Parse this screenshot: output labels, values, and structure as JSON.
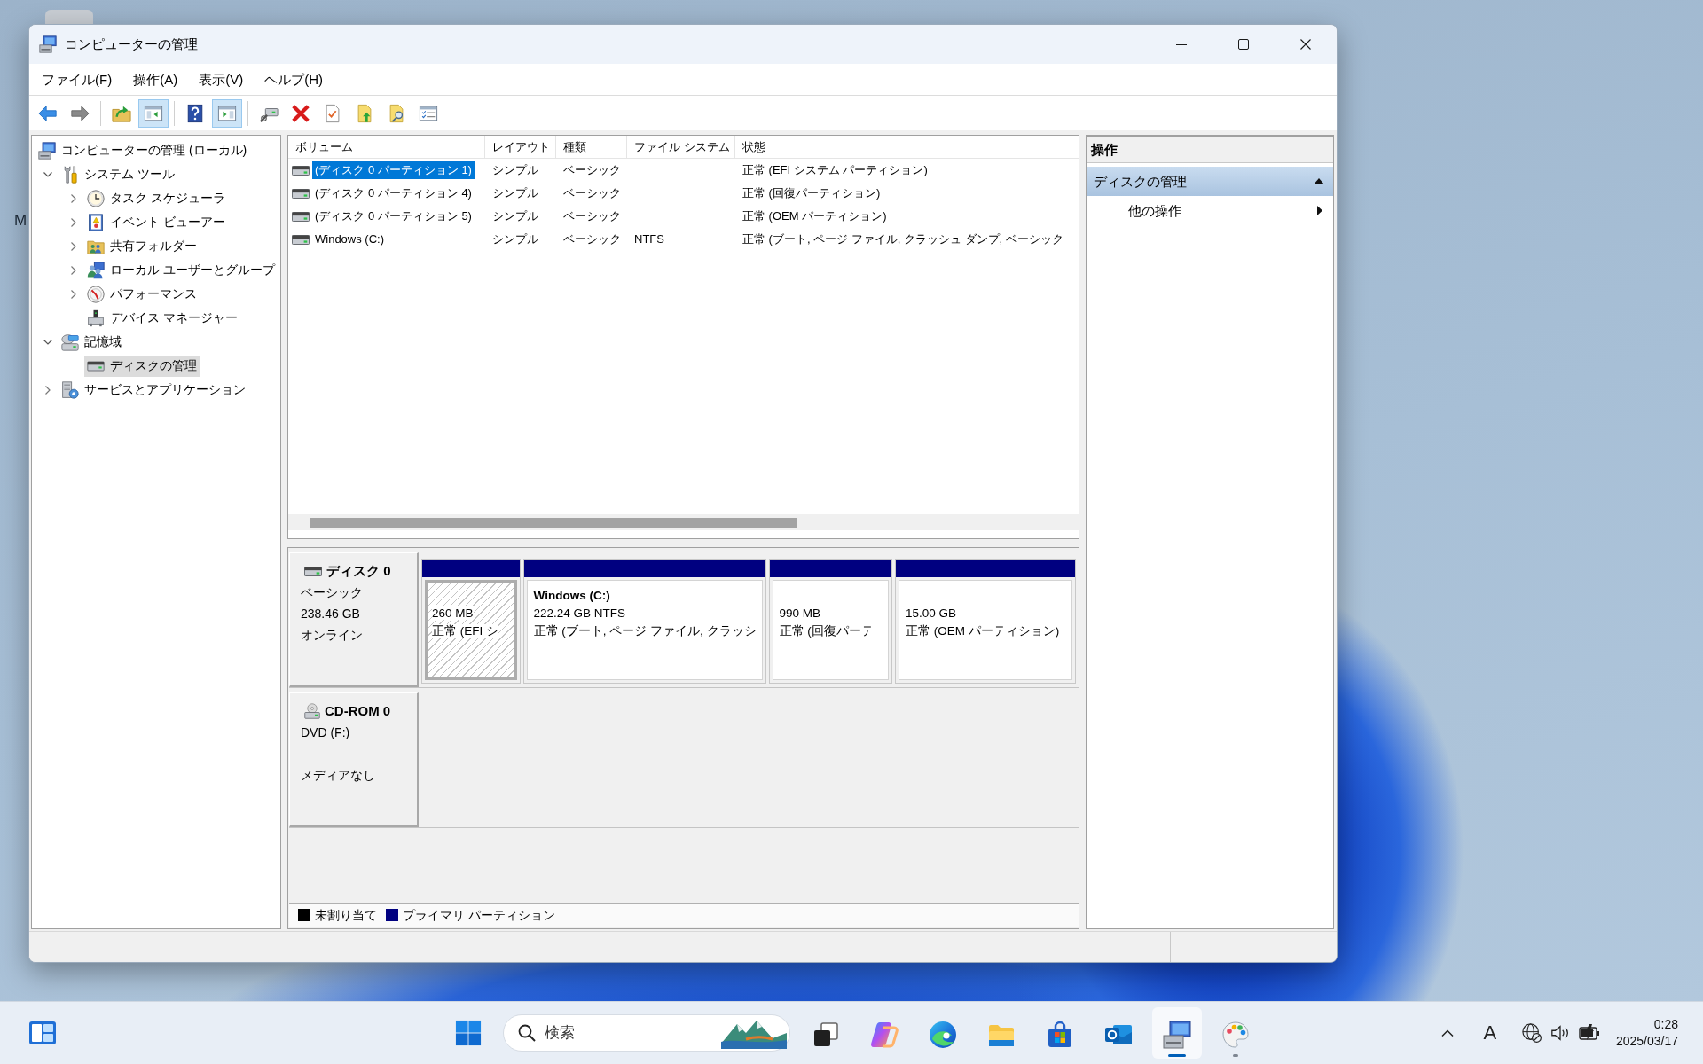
{
  "desktop": {
    "edge_text": "M"
  },
  "window": {
    "title": "コンピューターの管理"
  },
  "menu": [
    "ファイル(F)",
    "操作(A)",
    "表示(V)",
    "ヘルプ(H)"
  ],
  "toolbar": [
    [
      {
        "kind": "back",
        "pressed": false,
        "disabled": false
      },
      {
        "kind": "forward",
        "pressed": false,
        "disabled": true
      }
    ],
    [
      {
        "kind": "up",
        "pressed": false,
        "disabled": false
      },
      {
        "kind": "tree",
        "pressed": true,
        "disabled": false
      }
    ],
    [
      {
        "kind": "help",
        "pressed": false,
        "disabled": false
      },
      {
        "kind": "pane",
        "pressed": true,
        "disabled": false
      }
    ],
    [
      {
        "kind": "connect",
        "pressed": false,
        "disabled": false
      },
      {
        "kind": "delete",
        "pressed": false,
        "disabled": false
      },
      {
        "kind": "properties",
        "pressed": false,
        "disabled": false
      },
      {
        "kind": "export",
        "pressed": false,
        "disabled": false
      },
      {
        "kind": "find",
        "pressed": false,
        "disabled": false
      },
      {
        "kind": "list",
        "pressed": false,
        "disabled": false
      }
    ]
  ],
  "tree": {
    "label": "コンピューターの管理 (ローカル)",
    "kind": "computer",
    "selected": false,
    "children": [
      {
        "label": "システム ツール",
        "kind": "tools",
        "expanded": true,
        "selected": false,
        "children": [
          {
            "label": "タスク スケジューラ",
            "kind": "clock",
            "expanded": false,
            "selected": false
          },
          {
            "label": "イベント ビューアー",
            "kind": "events",
            "expanded": false,
            "selected": false
          },
          {
            "label": "共有フォルダー",
            "kind": "shared",
            "expanded": false,
            "selected": false
          },
          {
            "label": "ローカル ユーザーとグループ",
            "kind": "users",
            "expanded": false,
            "selected": false
          },
          {
            "label": "パフォーマンス",
            "kind": "performance",
            "expanded": false,
            "selected": false
          },
          {
            "label": "デバイス マネージャー",
            "kind": "devices",
            "selected": false
          }
        ]
      },
      {
        "label": "記憶域",
        "kind": "storage",
        "expanded": true,
        "selected": false,
        "children": [
          {
            "label": "ディスクの管理",
            "kind": "disk",
            "selected": true
          }
        ]
      },
      {
        "label": "サービスとアプリケーション",
        "kind": "services",
        "expanded": false,
        "selected": false
      }
    ]
  },
  "volumes": {
    "columns": [
      "ボリューム",
      "レイアウト",
      "種類",
      "ファイル システム",
      "状態"
    ],
    "rows": [
      {
        "volume": "(ディスク 0 パーティション 1)",
        "layout": "シンプル",
        "type": "ベーシック",
        "status": "正常 (EFI システム パーティション)",
        "selected": true
      },
      {
        "volume": "(ディスク 0 パーティション 4)",
        "layout": "シンプル",
        "type": "ベーシック",
        "status": "正常 (回復パーティション)",
        "selected": false
      },
      {
        "volume": "(ディスク 0 パーティション 5)",
        "layout": "シンプル",
        "type": "ベーシック",
        "status": "正常 (OEM パーティション)",
        "selected": false
      },
      {
        "volume": "Windows (C:)",
        "layout": "シンプル",
        "type": "ベーシック",
        "file_system": "NTFS",
        "status": "正常 (ブート, ページ ファイル, クラッシュ ダンプ, ベーシック",
        "selected": false
      }
    ]
  },
  "disks": [
    {
      "kind": "disk",
      "name": "ディスク 0",
      "type": "ベーシック",
      "capacity": "238.46 GB",
      "status": "オンライン",
      "partitions": [
        {
          "kind": "primary",
          "size": "260 MB",
          "status": "正常 (EFI シ",
          "selected": true
        },
        {
          "kind": "primary",
          "name": "Windows (C:)",
          "size": "222.24 GB NTFS",
          "status": "正常 (ブート, ページ ファイル, クラッシ",
          "selected": false
        },
        {
          "kind": "primary",
          "size": "990 MB",
          "status": "正常 (回復パーテ",
          "selected": false
        },
        {
          "kind": "primary",
          "size": "15.00 GB",
          "status": "正常 (OEM パーティション)",
          "selected": false
        }
      ]
    },
    {
      "kind": "cdrom",
      "name": "CD-ROM 0",
      "type": "DVD (F:)",
      "status": "メディアなし"
    }
  ],
  "legend": [
    {
      "kind": "unallocated",
      "label": "未割り当て",
      "color": "#000000"
    },
    {
      "kind": "primary",
      "label": "プライマリ パーティション",
      "color": "#000080"
    }
  ],
  "actions": {
    "title": "操作",
    "sections": [
      {
        "label": "ディスクの管理",
        "expanded": true,
        "items": [
          {
            "label": "他の操作",
            "submenu": true
          }
        ]
      }
    ]
  },
  "taskbar": {
    "search": {
      "placeholder": "検索"
    },
    "apps": [
      {
        "kind": "taskview",
        "running": false,
        "active": false
      },
      {
        "kind": "assistant",
        "running": false,
        "active": false
      },
      {
        "kind": "browser",
        "running": false,
        "active": false
      },
      {
        "kind": "files",
        "running": false,
        "active": false
      },
      {
        "kind": "store",
        "running": false,
        "active": false
      },
      {
        "kind": "mail",
        "running": false,
        "active": false
      },
      {
        "kind": "management",
        "running": true,
        "active": true
      },
      {
        "kind": "paint",
        "running": true,
        "active": false
      }
    ],
    "ime": "A",
    "clock": {
      "time": "0:28",
      "date": "2025/03/17"
    }
  }
}
